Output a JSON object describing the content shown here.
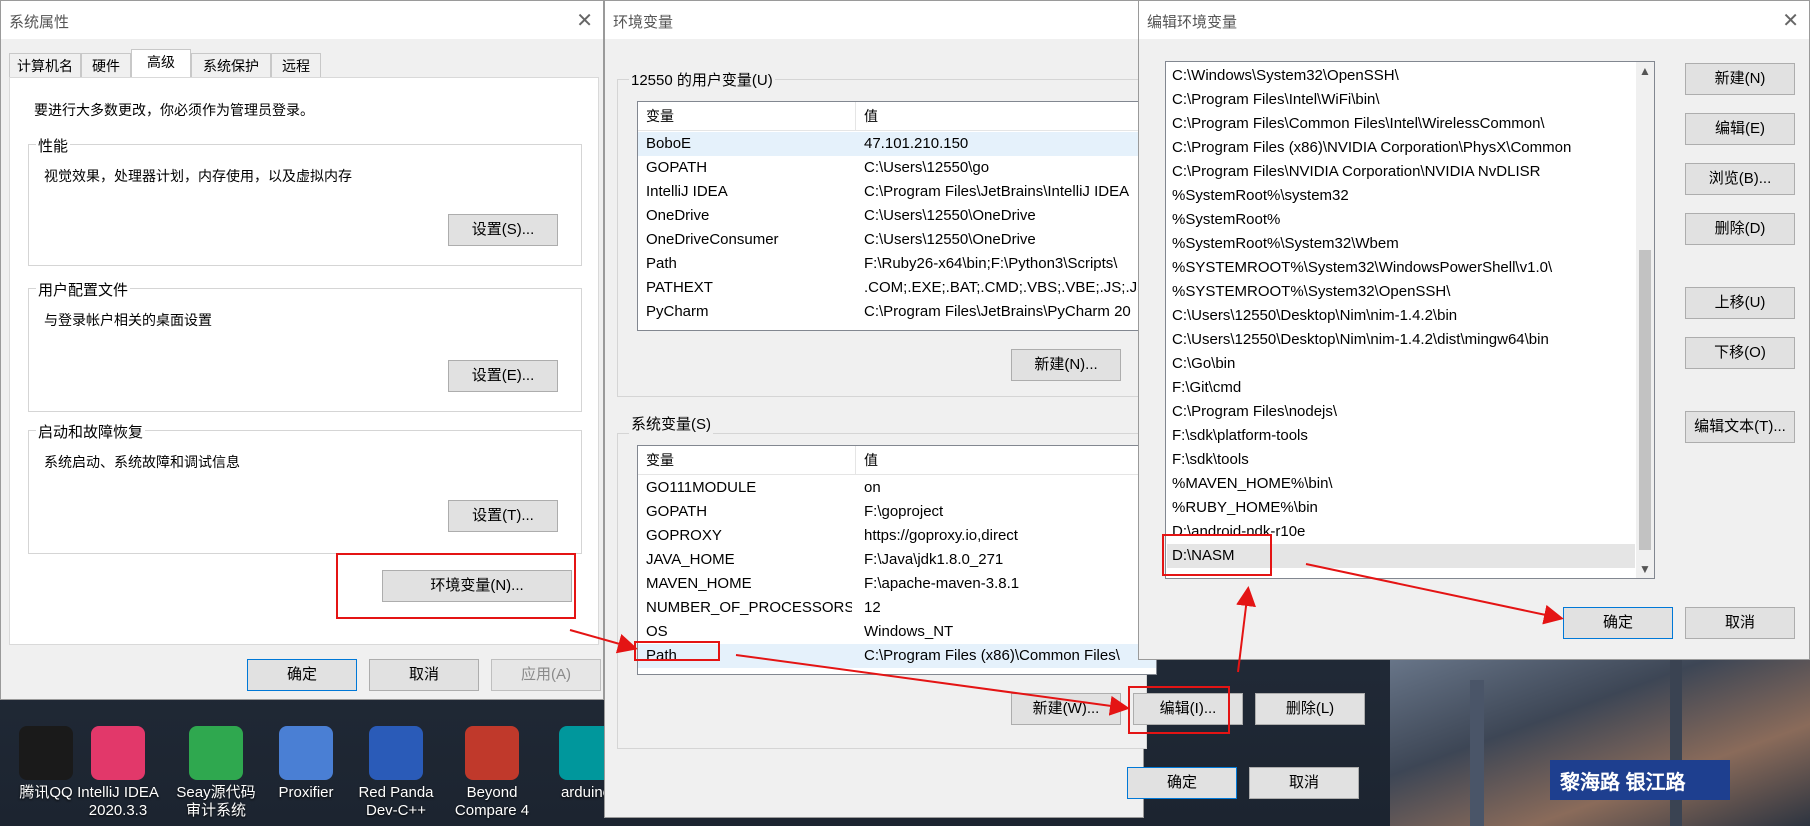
{
  "sys_props": {
    "title": "系统属性",
    "close": "✕",
    "tabs": [
      "计算机名",
      "硬件",
      "高级",
      "系统保护",
      "远程"
    ],
    "admin_note": "要进行大多数更改，你必须作为管理员登录。",
    "performance": {
      "label": "性能",
      "desc": "视觉效果，处理器计划，内存使用，以及虚拟内存",
      "button": "设置(S)..."
    },
    "user_profile": {
      "label": "用户配置文件",
      "desc": "与登录帐户相关的桌面设置",
      "button": "设置(E)..."
    },
    "startup": {
      "label": "启动和故障恢复",
      "desc": "系统启动、系统故障和调试信息",
      "button": "设置(T)..."
    },
    "env_button": "环境变量(N)...",
    "ok": "确定",
    "cancel": "取消",
    "apply": "应用(A)"
  },
  "env_vars": {
    "title": "环境变量",
    "user_section": "12550 的用户变量(U)",
    "col_var": "变量",
    "col_val": "值",
    "user_rows": [
      {
        "name": "BoboE",
        "value": "47.101.210.150"
      },
      {
        "name": "GOPATH",
        "value": "C:\\Users\\12550\\go"
      },
      {
        "name": "IntelliJ IDEA",
        "value": "C:\\Program Files\\JetBrains\\IntelliJ IDEA"
      },
      {
        "name": "OneDrive",
        "value": "C:\\Users\\12550\\OneDrive"
      },
      {
        "name": "OneDriveConsumer",
        "value": "C:\\Users\\12550\\OneDrive"
      },
      {
        "name": "Path",
        "value": "F:\\Ruby26-x64\\bin;F:\\Python3\\Scripts\\"
      },
      {
        "name": "PATHEXT",
        "value": ".COM;.EXE;.BAT;.CMD;.VBS;.VBE;.JS;.JSE"
      },
      {
        "name": "PyCharm",
        "value": "C:\\Program Files\\JetBrains\\PyCharm 20"
      }
    ],
    "user_new": "新建(N)...",
    "system_section": "系统变量(S)",
    "system_rows": [
      {
        "name": "GO111MODULE",
        "value": "on"
      },
      {
        "name": "GOPATH",
        "value": "F:\\goproject"
      },
      {
        "name": "GOPROXY",
        "value": "https://goproxy.io,direct"
      },
      {
        "name": "JAVA_HOME",
        "value": "F:\\Java\\jdk1.8.0_271"
      },
      {
        "name": "MAVEN_HOME",
        "value": "F:\\apache-maven-3.8.1"
      },
      {
        "name": "NUMBER_OF_PROCESSORS",
        "value": "12"
      },
      {
        "name": "OS",
        "value": "Windows_NT"
      },
      {
        "name": "Path",
        "value": "C:\\Program Files (x86)\\Common Files\\"
      }
    ],
    "sys_new": "新建(W)...",
    "sys_edit": "编辑(I)...",
    "sys_delete": "删除(L)",
    "ok": "确定",
    "cancel": "取消"
  },
  "edit_env": {
    "title": "编辑环境变量",
    "close": "✕",
    "items": [
      "C:\\Windows\\System32\\OpenSSH\\",
      "C:\\Program Files\\Intel\\WiFi\\bin\\",
      "C:\\Program Files\\Common Files\\Intel\\WirelessCommon\\",
      "C:\\Program Files (x86)\\NVIDIA Corporation\\PhysX\\Common",
      "C:\\Program Files\\NVIDIA Corporation\\NVIDIA NvDLISR",
      "%SystemRoot%\\system32",
      "%SystemRoot%",
      "%SystemRoot%\\System32\\Wbem",
      "%SYSTEMROOT%\\System32\\WindowsPowerShell\\v1.0\\",
      "%SYSTEMROOT%\\System32\\OpenSSH\\",
      "C:\\Users\\12550\\Desktop\\Nim\\nim-1.4.2\\bin",
      "C:\\Users\\12550\\Desktop\\Nim\\nim-1.4.2\\dist\\mingw64\\bin",
      "C:\\Go\\bin",
      "F:\\Git\\cmd",
      "C:\\Program Files\\nodejs\\",
      "F:\\sdk\\platform-tools",
      "F:\\sdk\\tools",
      "%MAVEN_HOME%\\bin\\",
      "%RUBY_HOME%\\bin",
      "D:\\android-ndk-r10e",
      "D:\\NASM"
    ],
    "btn_new": "新建(N)",
    "btn_edit": "编辑(E)",
    "btn_browse": "浏览(B)...",
    "btn_delete": "删除(D)",
    "btn_up": "上移(U)",
    "btn_down": "下移(O)",
    "btn_edit_text": "编辑文本(T)...",
    "ok": "确定",
    "cancel": "取消"
  },
  "desktop": {
    "icons": [
      {
        "label": "腾讯QQ",
        "color": "#1a1a1a"
      },
      {
        "label": "IntelliJ IDEA 2020.3.3",
        "color": "#e2386a"
      },
      {
        "label": "Seay源代码审计系统",
        "color": "#2fa84f"
      },
      {
        "label": "Proxifier",
        "color": "#4a7fd4"
      },
      {
        "label": "Red Panda Dev-C++",
        "color": "#2a5bb8"
      },
      {
        "label": "Beyond Compare 4",
        "color": "#c0392b"
      },
      {
        "label": "arduino",
        "color": "#00979c"
      }
    ],
    "sign_text": "黎海路 银江路"
  }
}
